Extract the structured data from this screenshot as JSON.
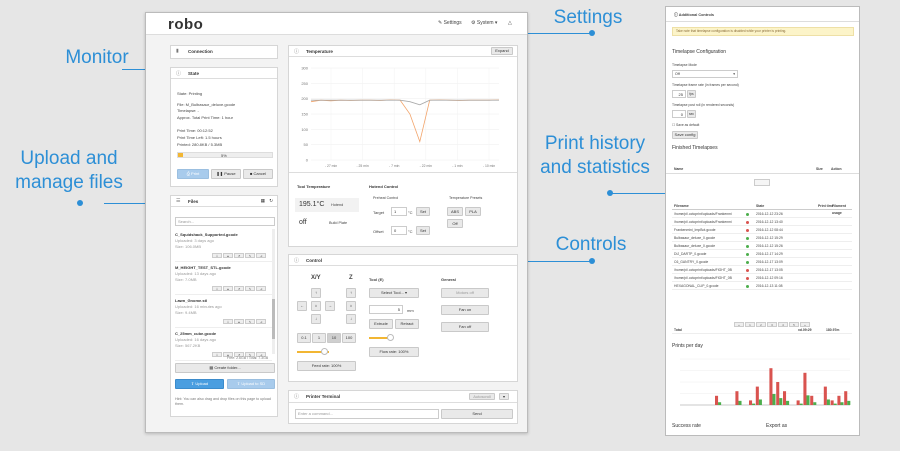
{
  "callouts": {
    "monitor": "Monitor",
    "upload": "Upload and manage files",
    "settings": "Settings",
    "history": "Print history and statistics",
    "controls": "Controls"
  },
  "header": {
    "logo": "robo",
    "settings": "Settings",
    "system": "System"
  },
  "connection": {
    "title": "Connection"
  },
  "state": {
    "title": "State",
    "lines": [
      "State: Printing",
      "File: M_Bulbasaur_deluxe.gcode",
      "Timelapse: -",
      "Approx. Total Print Time: 1 hour",
      "Print Time: 00:12:52",
      "Print Time Left: 1.5 hours",
      "Printed: 280.8KB / 5.3MB"
    ],
    "progress_label": "5%",
    "progress": 0.05,
    "print": "Print",
    "pause": "Pause",
    "cancel": "Cancel"
  },
  "files": {
    "title": "Files",
    "search": "Search...",
    "items": [
      {
        "name": "C_Squidshack_Supported.gcode",
        "meta1": "Uploaded: 3 days ago",
        "meta2": "Size: 106.0MB"
      },
      {
        "name": "M_HEIGHT_TEST_STL.gcode",
        "meta1": "Uploaded: 13 days ago",
        "meta2": "Size: 7.0MB"
      },
      {
        "name": "Lawn_Gnome.stl",
        "meta1": "Uploaded: 16 minutes ago",
        "meta2": "Size: 9.4MB"
      },
      {
        "name": "C_25mm_cube.gcode",
        "meta1": "Uploaded: 16 days ago",
        "meta2": "Size: 567.2KB"
      }
    ],
    "free": "Free: 2.6GB / Total: 7.3GB",
    "create_folder": "Create folder...",
    "upload": "Upload",
    "upload_sd": "Upload to SD",
    "hint": "Hint: You can also drag and drop files on this page to upload them."
  },
  "temperature": {
    "title": "Temperature",
    "expand": "Expand",
    "y_ticks": [
      "300",
      "250",
      "200",
      "150",
      "100",
      "50",
      "0"
    ],
    "x_ticks": [
      "- 27 min",
      "- 25 min",
      "- 7 min",
      "- 22 min",
      "- 1 min",
      "- 10 min"
    ],
    "tool_label": "Tool Temperature",
    "hotend_label": "Hotend Control",
    "tool_temp": "195.1°C",
    "hotend": "Hotend",
    "bed": "off",
    "bed_label": "Build Plate",
    "preheat": "Preheat Control",
    "target": "Target",
    "target_val": "1",
    "unit": "°C",
    "set": "Set",
    "offset": "Offset",
    "offset_val": "0",
    "presets": "Temperature Presets",
    "abs": "ABS",
    "pla": "PLA",
    "off": "Off"
  },
  "chart_data": {
    "type": "line",
    "ylim": [
      0,
      300
    ],
    "y_ticks": [
      "300",
      "250",
      "200",
      "150",
      "100",
      "50",
      "0"
    ],
    "x_ticks": [
      "- 27 min",
      "- 25 min",
      "- 7 min",
      "- 22 min",
      "- 1 min",
      "- 10 min"
    ],
    "series": [
      {
        "values": [
          190,
          195,
          193,
          195,
          194,
          195,
          195,
          194,
          196,
          195,
          150,
          60,
          195,
          196,
          195,
          194,
          195,
          195,
          195,
          196
        ]
      },
      {
        "values": [
          195,
          195,
          195,
          195,
          195,
          195,
          195,
          195,
          195,
          195,
          190,
          180,
          195,
          195,
          195,
          195,
          195,
          195,
          195,
          195
        ]
      }
    ]
  },
  "control": {
    "title": "Control",
    "xy": "X/Y",
    "z": "Z",
    "tool": "Tool (E)",
    "general": "General",
    "select_tool": "Select Tool...",
    "mm_val": "5",
    "mm": "mm",
    "extrude": "Extrude",
    "retract": "Retract",
    "motors_off": "Motors off",
    "fan_on": "Fan on",
    "fan_off": "Fan off",
    "steps": [
      "0.1",
      "1",
      "10",
      "100"
    ],
    "feed": "Feed rate: 100%",
    "flow": "Flow rate: 100%"
  },
  "terminal": {
    "title": "Printer Terminal",
    "autoscroll": "Autoscroll",
    "command": "Enter a command...",
    "send": "Send"
  },
  "history": {
    "title": "Additional Controls",
    "warn": "Take note that timelapse configuration is disabled while your printer is printing.",
    "timelapse_title": "Timelapse Configuration",
    "mode_label": "Timelapse Mode",
    "mode": "Off",
    "fps_label": "Timelapse frame rate (in frames per second)",
    "fps": "25",
    "fps_unit": "fps",
    "post_label": "Timelapse post roll (in rendered seconds)",
    "post": "0",
    "post_unit": "sec",
    "save_default": "Save as default",
    "save_config": "Save config",
    "finished": "Finished Timelapses",
    "name": "Name",
    "size": "Size",
    "action": "Action",
    "cols": [
      "Filename",
      "State",
      "Print time",
      "Filament usage"
    ],
    "rows": [
      {
        "f": "/home/pi/.octoprint/uploads/Frankenmi",
        "d": "2016-12-12 23:26",
        "ok": true
      },
      {
        "f": "/home/pi/.octoprint/uploads/Frankenmi",
        "d": "2016-12-12 13:40",
        "ok": false
      },
      {
        "f": "Frankenmini_ImpBot.gcode",
        "d": "2016-12-12 08:44",
        "ok": false
      },
      {
        "f": "Bulbasaur_deluxe_0.gcode",
        "d": "2016-12-12 15:29",
        "ok": true
      },
      {
        "f": "Bulbasaur_deluxe_0.gcode",
        "d": "2016-12-12 15:26",
        "ok": true
      },
      {
        "f": "DIJ_DARTP_0.gcode",
        "d": "2016-12-17 14:29",
        "ok": true
      },
      {
        "f": "C6_GANTRY_0.gcode",
        "d": "2016-12-17 13:09",
        "ok": true
      },
      {
        "f": "/home/pi/.octoprint/uploads/FIGHT_0B",
        "d": "2016-12-17 13:05",
        "ok": false
      },
      {
        "f": "/home/pi/.octoprint/uploads/FIGHT_0B",
        "d": "2016-12-12 09:16",
        "ok": false
      },
      {
        "f": "HEXAGONAL_CLIP_0.gcode",
        "d": "2016-12-13 11:08",
        "ok": true
      }
    ],
    "total": "Total",
    "total_time": "xd.09:29",
    "total_fil": "180.97m",
    "per_day": "Prints per day",
    "success": "Success rate",
    "export": "Export as",
    "bars": [
      0,
      0,
      0,
      0,
      0,
      0.2,
      0,
      0,
      0.3,
      0,
      0.1,
      0.4,
      0,
      0.8,
      0.5,
      0.3,
      0,
      0.1,
      0.7,
      0.2,
      0,
      0.4,
      0.1,
      0.2,
      0.3
    ]
  },
  "colors": {
    "accent": "#2d8fd6",
    "button": "#4a9ee0",
    "graph_target": "#f2a46b",
    "graph_actual": "#aaaaaa"
  }
}
